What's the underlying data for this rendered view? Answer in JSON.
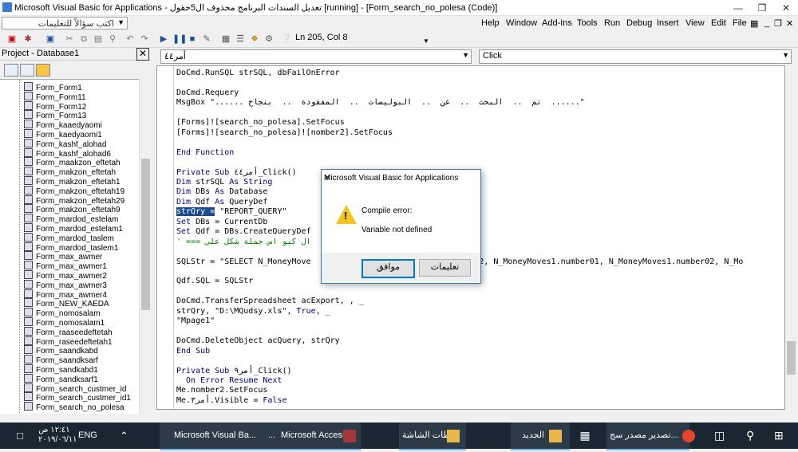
{
  "window": {
    "title": "Microsoft Visual Basic for Applications - تعديل السندات البرنامج محذوف ال5حقول [running] - [Form_search_no_polesa (Code)]"
  },
  "menubar": {
    "items": [
      "Help",
      "Window",
      "Add-Ins",
      "Tools",
      "Run",
      "Debug",
      "Insert",
      "View",
      "Edit",
      "File"
    ],
    "ask_placeholder": "اكتب سؤالاً للتعليمات"
  },
  "toolbar": {
    "position": "Ln 205, Col 8"
  },
  "project": {
    "title": "Project - Database1",
    "items": [
      "Form_Form1",
      "Form_Form11",
      "Form_Form12",
      "Form_Form13",
      "Form_kaaedyaomi",
      "Form_kaedyaomi1",
      "Form_kashf_alohad",
      "Form_kashf_alohad6",
      "Form_maakzon_eftetah",
      "Form_makzon_eftetah",
      "Form_makzon_eftetah1",
      "Form_makzon_eftetah19",
      "Form_makzon_eftetah29",
      "Form_makzon_eftetah9",
      "Form_mardod_estelam",
      "Form_mardod_estelam1",
      "Form_mardod_taslem",
      "Form_mardod_taslem1",
      "Form_max_awmer",
      "Form_max_awmer1",
      "Form_max_awmer2",
      "Form_max_awmer3",
      "Form_max_awmer4",
      "Form_NEW_KAEDA",
      "Form_nomosalam",
      "Form_nomosalam1",
      "Form_raaseedeftetah",
      "Form_raseedeftetah1",
      "Form_saandkabd",
      "Form_saandksarf",
      "Form_sandkabd1",
      "Form_sandksarf1",
      "Form_search_custmer_id",
      "Form_search_custmer_id1",
      "Form_search_no_polesa"
    ]
  },
  "code": {
    "object_combo": "أمر٤٤",
    "proc_combo": "Click",
    "lines": [
      [
        {
          "t": "DoCmd.RunSQL strSQL, dbFailOnError"
        }
      ],
      [
        {
          "t": ""
        }
      ],
      [
        {
          "t": "DoCmd.Requery"
        }
      ],
      [
        {
          "t": "MsgBox \"...... تم  ..  البحث  ..  عن  ..  البوليصات  ..  المفقودة  ..  بنجاح  ......\""
        }
      ],
      [
        {
          "t": ""
        }
      ],
      [
        {
          "t": "[Forms]![search_no_polesa].SetFocus"
        }
      ],
      [
        {
          "t": "[Forms]![search_no_polesa]![nomber2].SetFocus"
        }
      ],
      [
        {
          "t": ""
        }
      ],
      [
        {
          "t": "End Function",
          "c": "kw"
        }
      ],
      [
        {
          "t": ""
        }
      ],
      [
        {
          "t": "Private Sub ",
          "c": "kw"
        },
        {
          "t": "أمر٤٤_Click()"
        }
      ],
      [
        {
          "t": "Dim ",
          "c": "kw"
        },
        {
          "t": "strSQL "
        },
        {
          "t": "As String",
          "c": "kw"
        }
      ],
      [
        {
          "t": "Dim ",
          "c": "kw"
        },
        {
          "t": "DBs "
        },
        {
          "t": "As ",
          "c": "kw"
        },
        {
          "t": "Database"
        }
      ],
      [
        {
          "t": "Dim ",
          "c": "kw"
        },
        {
          "t": "Qdf "
        },
        {
          "t": "As ",
          "c": "kw"
        },
        {
          "t": "QueryDef"
        }
      ],
      [
        {
          "t": "strQry =",
          "c": "sel"
        },
        {
          "t": " \"REPORT_QUERY\""
        }
      ],
      [
        {
          "t": "Set ",
          "c": "kw"
        },
        {
          "t": "DBs = CurrentDb"
        }
      ],
      [
        {
          "t": "Set ",
          "c": "kw"
        },
        {
          "t": "Qdf = DBs.CreateQueryDef"
        }
      ],
      [
        {
          "t": "' === ال كيو اس جملة شكل على",
          "c": "cm"
        }
      ],
      [
        {
          "t": ""
        }
      ],
      [
        {
          "t": "SQLStr = \"SELECT N_MoneyMove                               mber2, N_MoneyMoves1.number01, N_MoneyMoves1.number02, N_Mo"
        }
      ],
      [
        {
          "t": ""
        }
      ],
      [
        {
          "t": "Qdf.SQL = SQLStr"
        }
      ],
      [
        {
          "t": ""
        }
      ],
      [
        {
          "t": "DoCmd.TransferSpreadsheet acExport, , _"
        }
      ],
      [
        {
          "t": "strQry, \"D:\\MQudsy.xls\", "
        },
        {
          "t": "True",
          "c": "kw"
        },
        {
          "t": ", _"
        }
      ],
      [
        {
          "t": "\"Mpage1\""
        }
      ],
      [
        {
          "t": ""
        }
      ],
      [
        {
          "t": "DoCmd.DeleteObject acQuery, strQry"
        }
      ],
      [
        {
          "t": "End Sub",
          "c": "kw"
        }
      ],
      [
        {
          "t": ""
        }
      ],
      [
        {
          "t": "Private Sub ",
          "c": "kw"
        },
        {
          "t": "أمر٩_Click()"
        }
      ],
      [
        {
          "t": "  On Error Resume Next",
          "c": "kw"
        }
      ],
      [
        {
          "t": "Me.nomber2.SetFocus"
        }
      ],
      [
        {
          "t": "Me.أمر٣.Visible = "
        },
        {
          "t": "False",
          "c": "kw"
        }
      ]
    ]
  },
  "dialog": {
    "title": "Microsoft Visual Basic for Applications",
    "heading": "Compile error:",
    "message": "Variable not defined",
    "ok_label": "موافق",
    "help_label": "تعليمات"
  },
  "taskbar": {
    "time": "١٢:٤١ ص",
    "date": "٢٠١٩/٠٦/١١",
    "lang": "ENG",
    "apps": [
      "Microsoft Visual Ba...",
      "...",
      "Microsoft Access",
      "لقطات الشاشة",
      "الجديد",
      "تصدير مصدر سج..."
    ]
  },
  "colors": {
    "keyword": "#00008b",
    "comment": "#008000",
    "selection": "#1a4a8e",
    "taskbar": "#1a2733"
  }
}
